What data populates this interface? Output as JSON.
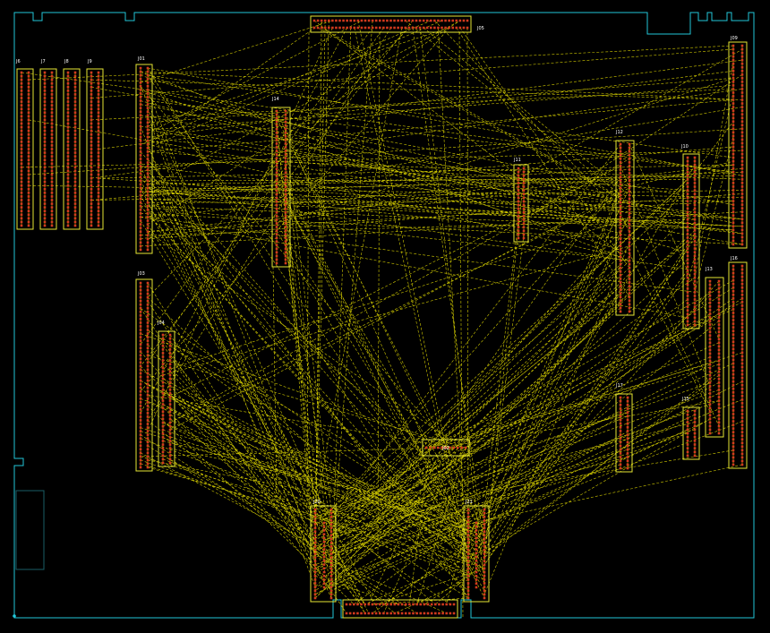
{
  "colors": {
    "background": "#000000",
    "outline": "#22c6d8",
    "ratsnest": "#e8e000",
    "silkscreen": "#e6e633",
    "pad": "#d23a1e",
    "label": "#ffffff"
  },
  "connectors": [
    {
      "id": "J1",
      "label": "J6"
    },
    {
      "id": "J2",
      "label": "J7"
    },
    {
      "id": "J3",
      "label": "J8"
    },
    {
      "id": "J4",
      "label": "J9"
    },
    {
      "id": "J5",
      "label": "J01"
    },
    {
      "id": "J6",
      "label": "J03"
    },
    {
      "id": "J7",
      "label": "J04"
    },
    {
      "id": "J8",
      "label": "J14"
    },
    {
      "id": "J9",
      "label": "J11"
    },
    {
      "id": "J10",
      "label": "J05"
    },
    {
      "id": "J11",
      "label": "J12"
    },
    {
      "id": "J12",
      "label": "J10"
    },
    {
      "id": "J13",
      "label": "J09"
    },
    {
      "id": "J14",
      "label": "J13"
    },
    {
      "id": "J15",
      "label": "J16"
    },
    {
      "id": "J16",
      "label": "J17"
    },
    {
      "id": "J17",
      "label": "J15"
    },
    {
      "id": "J18",
      "label": "J02"
    },
    {
      "id": "J19",
      "label": "J20"
    },
    {
      "id": "J20",
      "label": "J21"
    },
    {
      "id": "J21",
      "label": ""
    },
    {
      "id": "J22",
      "label": ""
    },
    {
      "id": "J23",
      "label": ""
    }
  ]
}
